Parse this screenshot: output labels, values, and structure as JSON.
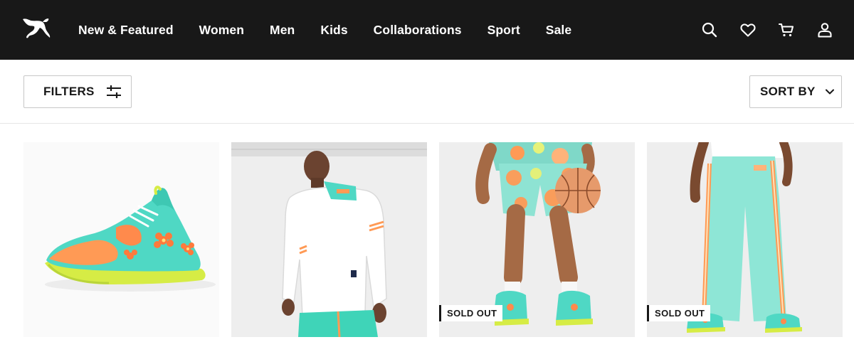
{
  "header": {
    "logo_icon": "puma-cat-logo-icon",
    "nav": [
      "New & Featured",
      "Women",
      "Men",
      "Kids",
      "Collaborations",
      "Sport",
      "Sale"
    ],
    "icons": [
      "search-icon",
      "heart-icon",
      "cart-icon",
      "user-icon"
    ]
  },
  "toolbar": {
    "filters_label": "FILTERS",
    "sort_label": "SORT BY"
  },
  "products": [
    {
      "image": "basketball shoe teal orange floral",
      "badge": ""
    },
    {
      "image": "model white quarter-zip jacket",
      "badge": ""
    },
    {
      "image": "model floral shorts with basketball",
      "badge": "SOLD OUT"
    },
    {
      "image": "model teal track pants",
      "badge": "SOLD OUT"
    }
  ],
  "colors": {
    "nav_bg": "#181818",
    "accent_teal": "#4fd8c4",
    "accent_orange": "#ff8a4c",
    "accent_lime": "#cde43a"
  }
}
